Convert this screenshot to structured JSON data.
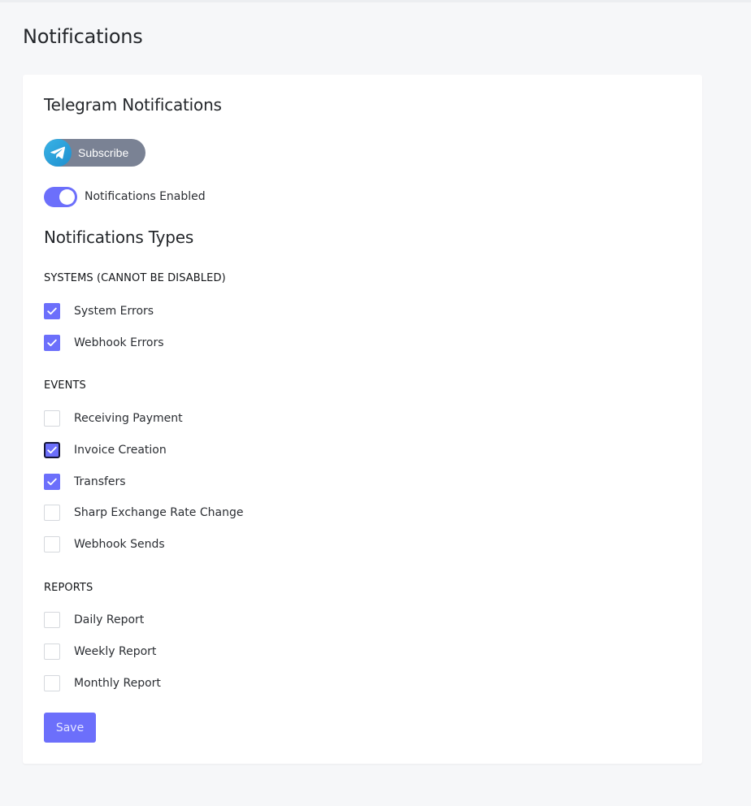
{
  "page": {
    "title": "Notifications"
  },
  "telegram": {
    "title": "Telegram Notifications",
    "subscribe_label": "Subscribe",
    "toggle_label": "Notifications Enabled",
    "toggle_on": true
  },
  "types": {
    "title": "Notifications Types",
    "groups": [
      {
        "label": "SYSTEMS (CANNOT BE DISABLED)",
        "items": [
          {
            "label": "System Errors",
            "checked": true
          },
          {
            "label": "Webhook Errors",
            "checked": true
          }
        ]
      },
      {
        "label": "EVENTS",
        "items": [
          {
            "label": "Receiving Payment",
            "checked": false
          },
          {
            "label": "Invoice Creation",
            "checked": true,
            "focused": true
          },
          {
            "label": "Transfers",
            "checked": true
          },
          {
            "label": "Sharp Exchange Rate Change",
            "checked": false
          },
          {
            "label": "Webhook Sends",
            "checked": false
          }
        ]
      },
      {
        "label": "REPORTS",
        "items": [
          {
            "label": "Daily Report",
            "checked": false
          },
          {
            "label": "Weekly Report",
            "checked": false
          },
          {
            "label": "Monthly Report",
            "checked": false
          }
        ]
      }
    ]
  },
  "actions": {
    "save_label": "Save"
  },
  "colors": {
    "accent": "#6c6ffb",
    "subscribe_bg": "#7a8294",
    "telegram_blue": "#2aa1dd",
    "page_bg": "#f6f7f9"
  },
  "icons": {
    "telegram": "telegram-icon",
    "check": "check-icon"
  }
}
